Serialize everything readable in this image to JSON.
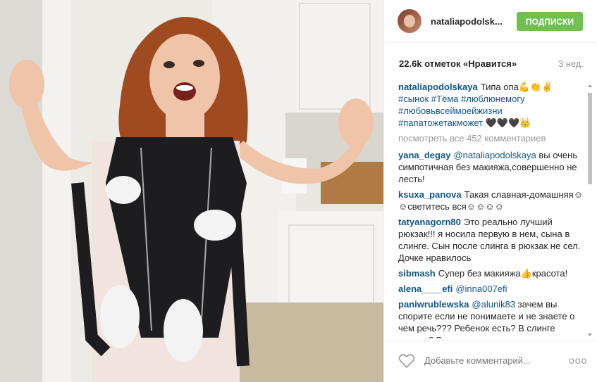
{
  "post": {
    "username": "nataliapodolsk...",
    "follow_label": "ПОДПИСКИ",
    "likes": "22.6k отметок «Нравится»",
    "time": "3 нед.",
    "caption_author": "nataliapodolskaya",
    "caption_text": "Типа опа💪👏✌",
    "caption_tags": [
      "#сынок",
      "#Тёма",
      "#люблюнемогу",
      "#любовьвсеймоейжизни",
      "#папатожетакможет"
    ],
    "caption_hearts": "🖤🖤🖤👑",
    "view_all": "посмотреть все 452 комментариев"
  },
  "comments": [
    {
      "author": "yana_degay",
      "mention": "@nataliapodolskaya",
      "text": "вы очень симпотичная без макияжа,совершенно не лесть!"
    },
    {
      "author": "ksuxa_panova",
      "text": "Такая славная-домашняя☺☺светитесь вся☺☺☺☺"
    },
    {
      "author": "tatyanagorn80",
      "text": "Это реально лучший рюкзак!!! я носила первую в нем, сына в слинге. Сын после слинга в рюкзак не сел. Дочке нравилось"
    },
    {
      "author": "sibmash",
      "text": "Супер без макияжа👍красота!"
    },
    {
      "author": "alena____efi",
      "mention": "@inna007efi",
      "text": ""
    },
    {
      "author": "paniwrublewska",
      "mention": "@alunik83",
      "text": "зачем вы спорите если не понимаете и не знаете о чем речь??? Ребенок есть? В слинге носили? В кенгуру пытались"
    }
  ],
  "footer": {
    "placeholder": "Добавьте комментарий...",
    "more": "ooo"
  },
  "colors": {
    "follow": "#70c050",
    "link": "#125688"
  },
  "icons": [
    "heart-icon",
    "more-options-icon"
  ]
}
